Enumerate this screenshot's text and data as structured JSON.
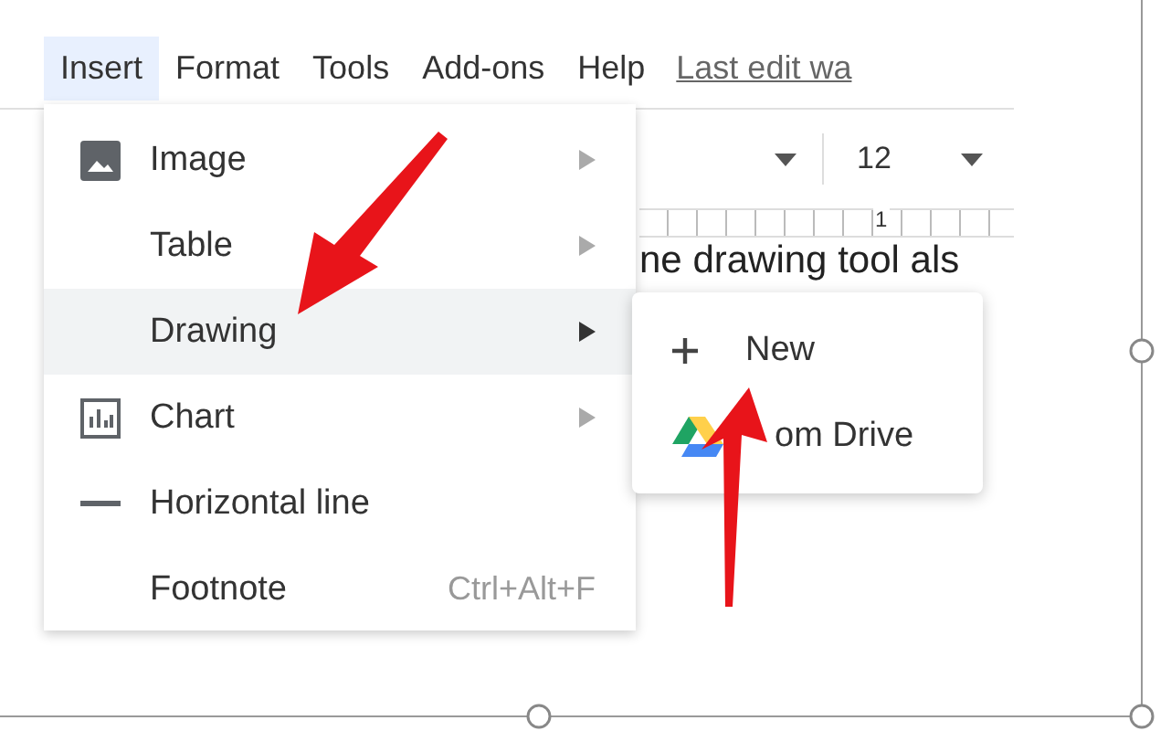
{
  "menu_bar": [
    {
      "label": "Insert",
      "selected": true
    },
    {
      "label": "Format",
      "selected": false
    },
    {
      "label": "Tools",
      "selected": false
    },
    {
      "label": "Add-ons",
      "selected": false
    },
    {
      "label": "Help",
      "selected": false
    }
  ],
  "last_edit": "Last edit wa",
  "toolbar": {
    "font_size": "12"
  },
  "ruler": {
    "mark": "1"
  },
  "document": {
    "text": "ne drawing tool als"
  },
  "insert_menu": [
    {
      "label": "Image",
      "kind": "image",
      "submenu": true,
      "selected": false
    },
    {
      "label": "Table",
      "kind": "none",
      "submenu": true,
      "selected": false
    },
    {
      "label": "Drawing",
      "kind": "none",
      "submenu": true,
      "selected": true
    },
    {
      "label": "Chart",
      "kind": "chart",
      "submenu": true,
      "selected": false
    },
    {
      "label": "Horizontal line",
      "kind": "line",
      "submenu": false,
      "selected": false
    },
    {
      "label": "Footnote",
      "kind": "none",
      "submenu": false,
      "selected": false,
      "shortcut": "Ctrl+Alt+F"
    }
  ],
  "drawing_submenu": [
    {
      "label": "New",
      "kind": "plus"
    },
    {
      "label": "om Drive",
      "kind": "drive"
    }
  ]
}
